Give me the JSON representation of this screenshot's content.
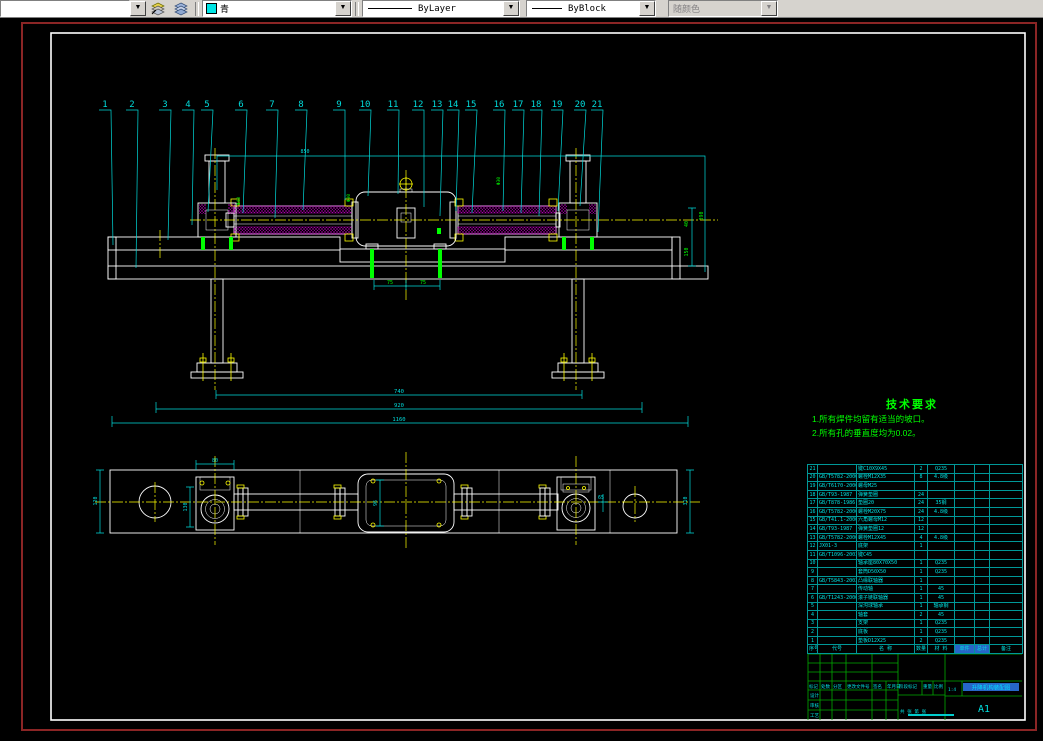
{
  "toolbar": {
    "layer_dropdown_arrow": "▼",
    "color_value": "青",
    "linetype_value": "ByLayer",
    "lineweight_value": "ByBlock",
    "plotstyle_value": "随颜色"
  },
  "colors": {
    "toolbar_gray": "#d6d3ce",
    "cad_cyan": "#00dcdc",
    "cad_green": "#00ff00",
    "cad_magenta": "#e800e8",
    "cad_yellow": "#ffff00",
    "cad_white": "#ffffff",
    "paper_border_red": "#8b2525",
    "selection_blue": "#2766c8"
  },
  "drawing": {
    "callouts": [
      "1",
      "2",
      "3",
      "4",
      "5",
      "6",
      "7",
      "8",
      "9",
      "10",
      "11",
      "12",
      "13",
      "14",
      "15",
      "16",
      "17",
      "18",
      "19",
      "20",
      "21"
    ],
    "tech_requirements": {
      "title": "技术要求",
      "lines": [
        "1.所有焊件均留有适当的坡口。",
        "2.所有孔的垂直度均为0.02。"
      ]
    },
    "dim_labels": {
      "top_width": "850",
      "right_h1": "40",
      "right_h2": "150",
      "right_total": "390",
      "span_feet": "740",
      "span_mid": "920",
      "span_total": "1160",
      "feet_l": "75",
      "feet_r": "75",
      "phi_left": "Φ40",
      "phi_mid": "Φ30",
      "phi_right": "Φ30",
      "plan_top": "80",
      "plan_left": "130",
      "plan_far_left": "120",
      "plan_right": "310",
      "plan_offset": "65",
      "plan_inner": "96"
    }
  },
  "bom": {
    "rows": [
      {
        "no": "21",
        "code": "",
        "name": "键C10X9X45",
        "qty": "2",
        "material": "Q235",
        "unit": "",
        "total": "",
        "remark": ""
      },
      {
        "no": "20",
        "code": "GB/T5782-2000",
        "name": "螺栓M12X35",
        "qty": "8",
        "material": "4.8级",
        "unit": "",
        "total": "",
        "remark": ""
      },
      {
        "no": "19",
        "code": "GB/T6170-2000",
        "name": "螺母M25",
        "qty": "",
        "material": "",
        "unit": "",
        "total": "",
        "remark": ""
      },
      {
        "no": "18",
        "code": "GB/T93-1987",
        "name": "弹簧垫圈",
        "qty": "24",
        "material": "",
        "unit": "",
        "total": "",
        "remark": ""
      },
      {
        "no": "17",
        "code": "GB/T878-1986",
        "name": "垫圈20",
        "qty": "24",
        "material": "35钢",
        "unit": "",
        "total": "",
        "remark": ""
      },
      {
        "no": "16",
        "code": "GB/T5782-2000",
        "name": "螺栓M20X75",
        "qty": "24",
        "material": "4.8级",
        "unit": "",
        "total": "",
        "remark": ""
      },
      {
        "no": "15",
        "code": "GB/T41.1-2000",
        "name": "六角螺母M12",
        "qty": "12",
        "material": "",
        "unit": "",
        "total": "",
        "remark": ""
      },
      {
        "no": "14",
        "code": "GB/T93-1987",
        "name": "弹簧垫圈12",
        "qty": "12",
        "material": "",
        "unit": "",
        "total": "",
        "remark": ""
      },
      {
        "no": "13",
        "code": "GB/T5782-2000",
        "name": "螺栓M12X45",
        "qty": "4",
        "material": "4.8级",
        "unit": "",
        "total": "",
        "remark": ""
      },
      {
        "no": "12",
        "code": "JX01-3",
        "name": "底架",
        "qty": "1",
        "material": "",
        "unit": "",
        "total": "",
        "remark": ""
      },
      {
        "no": "11",
        "code": "GB/T1096-2003",
        "name": "键C45",
        "qty": "",
        "material": "",
        "unit": "",
        "total": "",
        "remark": ""
      },
      {
        "no": "10",
        "code": "",
        "name": "轴承座80X70X50",
        "qty": "1",
        "material": "Q235",
        "unit": "",
        "total": "",
        "remark": ""
      },
      {
        "no": "9",
        "code": "",
        "name": "套筒D50X50",
        "qty": "1",
        "material": "Q235",
        "unit": "",
        "total": "",
        "remark": ""
      },
      {
        "no": "8",
        "code": "GB/T5843-2003",
        "name": "凸缘联轴器",
        "qty": "1",
        "material": "",
        "unit": "",
        "total": "",
        "remark": ""
      },
      {
        "no": "7",
        "code": "",
        "name": "传动轴",
        "qty": "1",
        "material": "45",
        "unit": "",
        "total": "",
        "remark": ""
      },
      {
        "no": "6",
        "code": "GB/T1243-2006",
        "name": "滚子链联轴器",
        "qty": "1",
        "material": "45",
        "unit": "",
        "total": "",
        "remark": ""
      },
      {
        "no": "5",
        "code": "",
        "name": "深沟球轴承",
        "qty": "1",
        "material": "轴承钢",
        "unit": "",
        "total": "",
        "remark": ""
      },
      {
        "no": "4",
        "code": "",
        "name": "轴套",
        "qty": "2",
        "material": "45",
        "unit": "",
        "total": "",
        "remark": ""
      },
      {
        "no": "3",
        "code": "",
        "name": "支架",
        "qty": "1",
        "material": "Q235",
        "unit": "",
        "total": "",
        "remark": ""
      },
      {
        "no": "2",
        "code": "",
        "name": "底板",
        "qty": "1",
        "material": "Q235",
        "unit": "",
        "total": "",
        "remark": ""
      },
      {
        "no": "1",
        "code": "",
        "name": "垫板D12X25",
        "qty": "2",
        "material": "Q235",
        "unit": "",
        "total": "",
        "remark": ""
      }
    ]
  },
  "title_block": {
    "header": [
      "序号",
      "代号",
      "名 称",
      "数量",
      "材 料",
      "单件",
      "总计",
      "备注"
    ],
    "labels": {
      "mark": "标记",
      "count": "处数",
      "zone": "分区",
      "file_no": "更改文件号",
      "sign": "签名",
      "date": "年月日",
      "design": "设计",
      "check": "审核",
      "process": "工艺",
      "stage": "阶段标记",
      "weight": "重量",
      "scale": "比例"
    },
    "scale_value": "1:4",
    "sheet_info": "共 张 第 张",
    "drawing_title": "升降机构装配图",
    "sheet_size": "A1"
  }
}
